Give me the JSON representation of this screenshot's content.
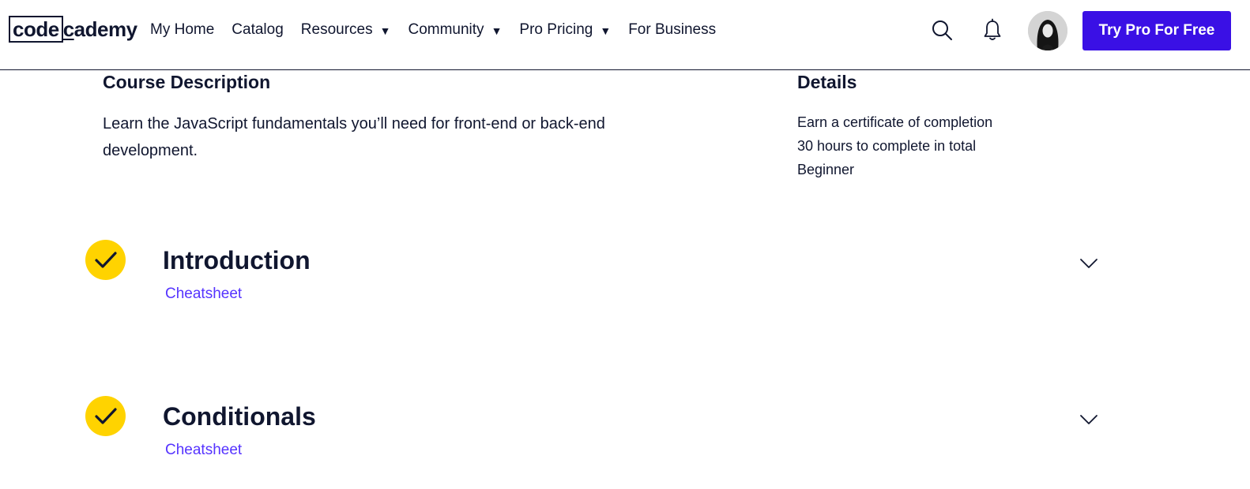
{
  "header": {
    "logo": {
      "boxed": "code",
      "rest_prefix": "",
      "rest_underlined": "c",
      "rest_suffix": "ademy"
    },
    "nav": [
      {
        "label": "My Home",
        "caret": false
      },
      {
        "label": "Catalog",
        "caret": false
      },
      {
        "label": "Resources",
        "caret": true
      },
      {
        "label": "Community",
        "caret": true
      },
      {
        "label": "Pro Pricing",
        "caret": true
      },
      {
        "label": "For Business",
        "caret": false
      }
    ],
    "caret_glyph": "▼",
    "icons": {
      "search": "search-icon",
      "notifications": "bell-icon"
    },
    "cta_label": "Try Pro For Free",
    "cta_color": "#3a10e5"
  },
  "description": {
    "heading": "Course Description",
    "text": "Learn the JavaScript fundamentals you’ll need for front-end or back-end development."
  },
  "details": {
    "heading": "Details",
    "items": [
      "Earn a certificate of completion",
      "30 hours to complete in total",
      "Beginner"
    ]
  },
  "modules": [
    {
      "title": "Introduction",
      "link": "Cheatsheet",
      "completed": true
    },
    {
      "title": "Conditionals",
      "link": "Cheatsheet",
      "completed": true
    }
  ],
  "colors": {
    "ink": "#10162f",
    "check": "#ffd300",
    "link": "#5533ff"
  }
}
